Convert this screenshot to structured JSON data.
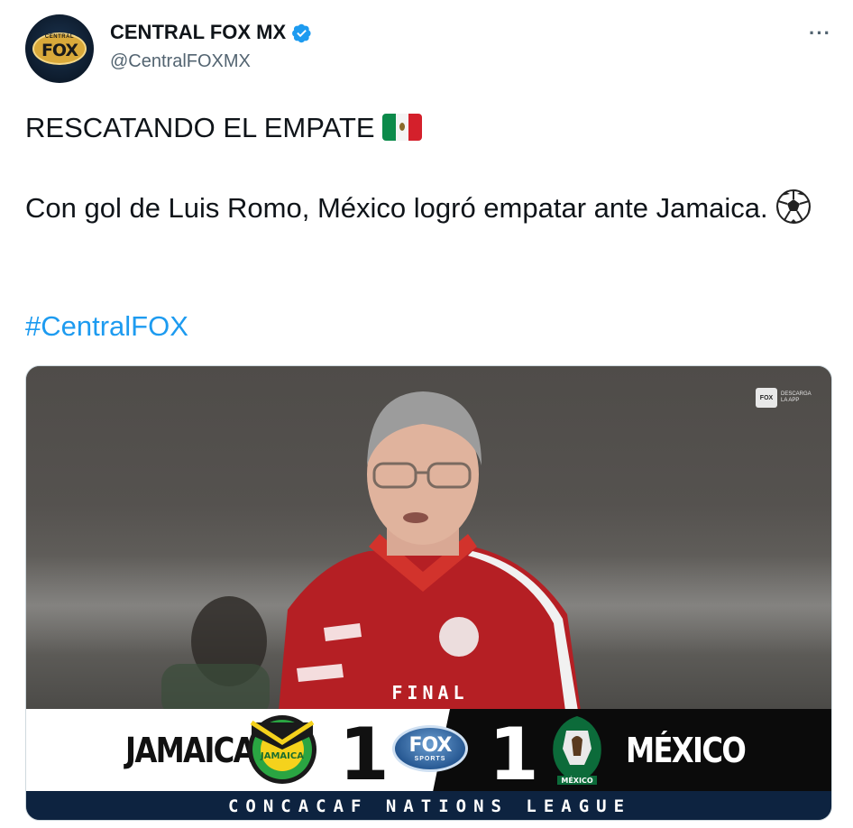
{
  "account": {
    "display_name": "CENTRAL FOX MX",
    "handle": "@CentralFOXMX",
    "avatar_text": "FOX",
    "avatar_subtext": "CENTRAL",
    "verified": true
  },
  "menu": {
    "more_label": "···"
  },
  "tweet": {
    "line1": "RESCATANDO EL EMPATE",
    "line1_emoji": "mexico-flag",
    "line2": "Con gol de Luis Romo, México logró empatar ante Jamaica.",
    "line2_emoji": "soccer-ball",
    "hashtag": "#CentralFOX"
  },
  "media": {
    "watermark_badge": "FOX",
    "watermark_text": "DESCARGA LA APP",
    "status_label": "FINAL",
    "home_team": "JAMAICA",
    "home_score": "1",
    "away_team": "MÉXICO",
    "away_score": "1",
    "broadcaster_logo": "FOX",
    "broadcaster_sub": "SPORTS",
    "competition": "CONCACAF NATIONS LEAGUE"
  },
  "colors": {
    "link": "#1d9bf0",
    "verified": "#1d9bf0",
    "league_bar": "#0d2340",
    "handle_gray": "#536471"
  }
}
